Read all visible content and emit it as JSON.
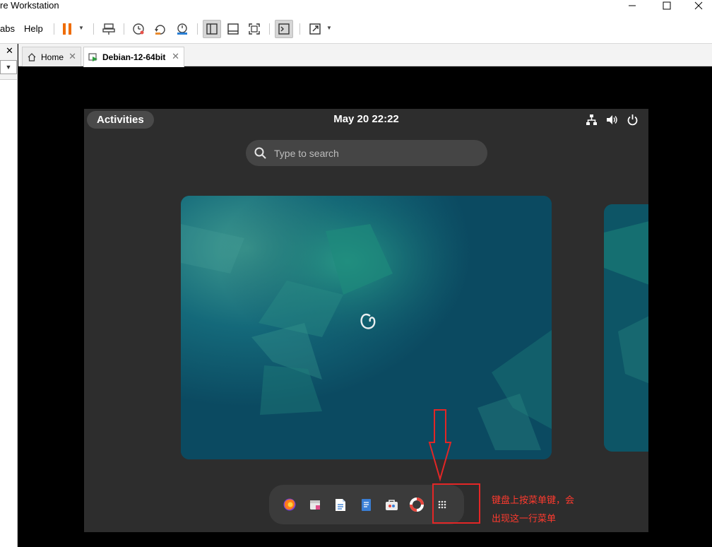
{
  "window": {
    "title": "re Workstation"
  },
  "menu": {
    "tabs_label": "abs",
    "help_label": "Help"
  },
  "tabs": [
    {
      "label": "Home"
    },
    {
      "label": "Debian-12-64bit"
    }
  ],
  "guest": {
    "activities_label": "Activities",
    "clock": "May 20  22:22",
    "search_placeholder": "Type to search"
  },
  "dock_apps": [
    "firefox-icon",
    "calendar-icon",
    "text-editor-icon",
    "document-icon",
    "software-icon",
    "help-icon",
    "show-apps-icon"
  ],
  "annotation": {
    "note_line1": "键盘上按菜单键，会",
    "note_line2": "出现这一行菜单"
  },
  "colors": {
    "pause_orange": "#ef6c00",
    "annotation_red": "#e32626",
    "debian_teal": "#0c4d63"
  }
}
